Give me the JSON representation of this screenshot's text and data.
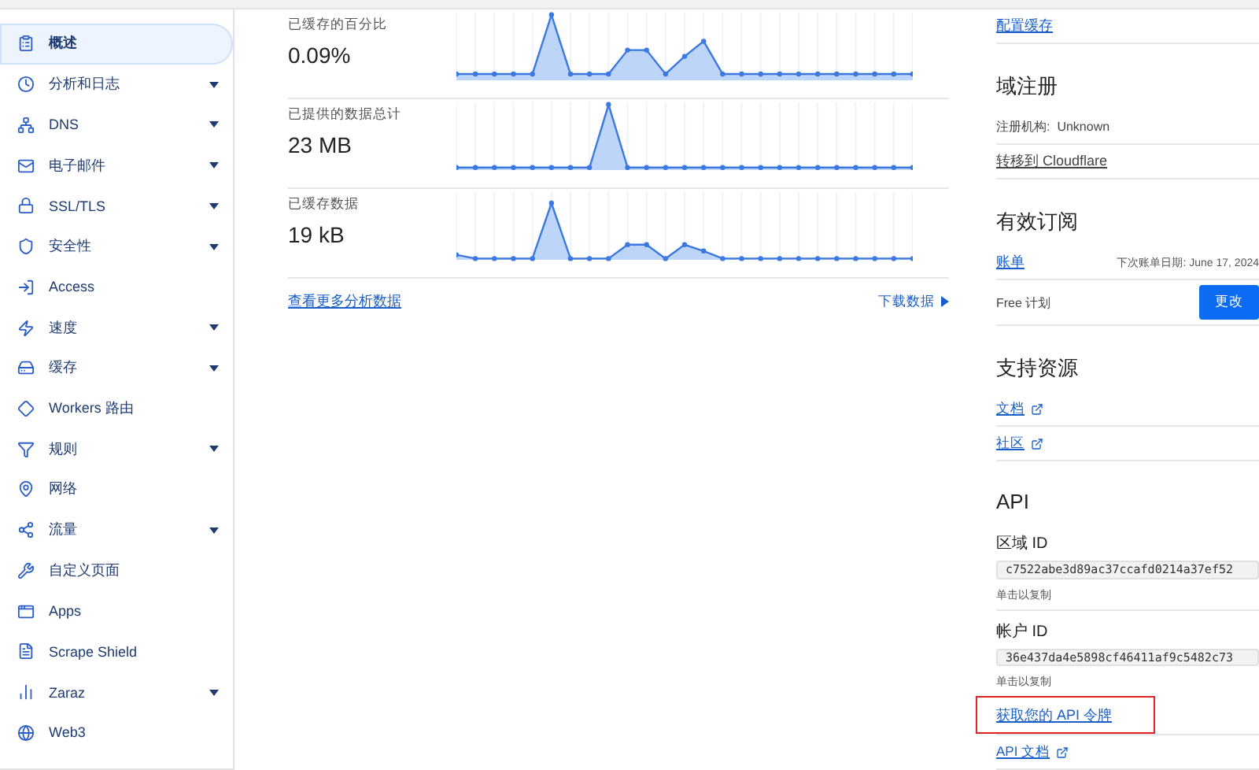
{
  "sidebar": {
    "items": [
      {
        "label": "概述",
        "selected": true,
        "expandable": false
      },
      {
        "label": "分析和日志",
        "selected": false,
        "expandable": true
      },
      {
        "label": "DNS",
        "selected": false,
        "expandable": true
      },
      {
        "label": "电子邮件",
        "selected": false,
        "expandable": true
      },
      {
        "label": "SSL/TLS",
        "selected": false,
        "expandable": true
      },
      {
        "label": "安全性",
        "selected": false,
        "expandable": true
      },
      {
        "label": "Access",
        "selected": false,
        "expandable": false
      },
      {
        "label": "速度",
        "selected": false,
        "expandable": true
      },
      {
        "label": "缓存",
        "selected": false,
        "expandable": true
      },
      {
        "label": "Workers 路由",
        "selected": false,
        "expandable": false
      },
      {
        "label": "规则",
        "selected": false,
        "expandable": true
      },
      {
        "label": "网络",
        "selected": false,
        "expandable": false
      },
      {
        "label": "流量",
        "selected": false,
        "expandable": true
      },
      {
        "label": "自定义页面",
        "selected": false,
        "expandable": false
      },
      {
        "label": "Apps",
        "selected": false,
        "expandable": false
      },
      {
        "label": "Scrape Shield",
        "selected": false,
        "expandable": false
      },
      {
        "label": "Zaraz",
        "selected": false,
        "expandable": true
      },
      {
        "label": "Web3",
        "selected": false,
        "expandable": false
      }
    ]
  },
  "stats": [
    {
      "label": "已缓存的百分比",
      "value": "0.09%"
    },
    {
      "label": "已提供的数据总计",
      "value": "23 MB"
    },
    {
      "label": "已缓存数据",
      "value": "19 kB"
    }
  ],
  "stats_links": {
    "more": "查看更多分析数据",
    "download": "下载数据"
  },
  "right": {
    "config_cache": "配置缓存",
    "domain": {
      "title": "域注册",
      "registrar_label": "注册机构:",
      "registrar": "Unknown",
      "transfer": "转移到 Cloudflare"
    },
    "subscription": {
      "title": "有效订阅",
      "billing": "账单",
      "next_billing": "下次账单日期: June 17, 2024",
      "plan": "Free 计划",
      "change_button": "更改"
    },
    "support": {
      "title": "支持资源",
      "links": [
        "文档",
        "社区"
      ]
    },
    "api": {
      "title": "API",
      "zone_label": "区域 ID",
      "zone_id": "c7522abe3d89ac37ccafd0214a37ef52",
      "zone_hint": "单击以复制",
      "account_label": "帐户 ID",
      "account_id": "36e437da4e5898cf46411af9c5482c73",
      "account_hint": "单击以复制",
      "token_link": "获取您的 API 令牌",
      "token_highlighted": true,
      "docs_link": "API 文档"
    }
  }
}
